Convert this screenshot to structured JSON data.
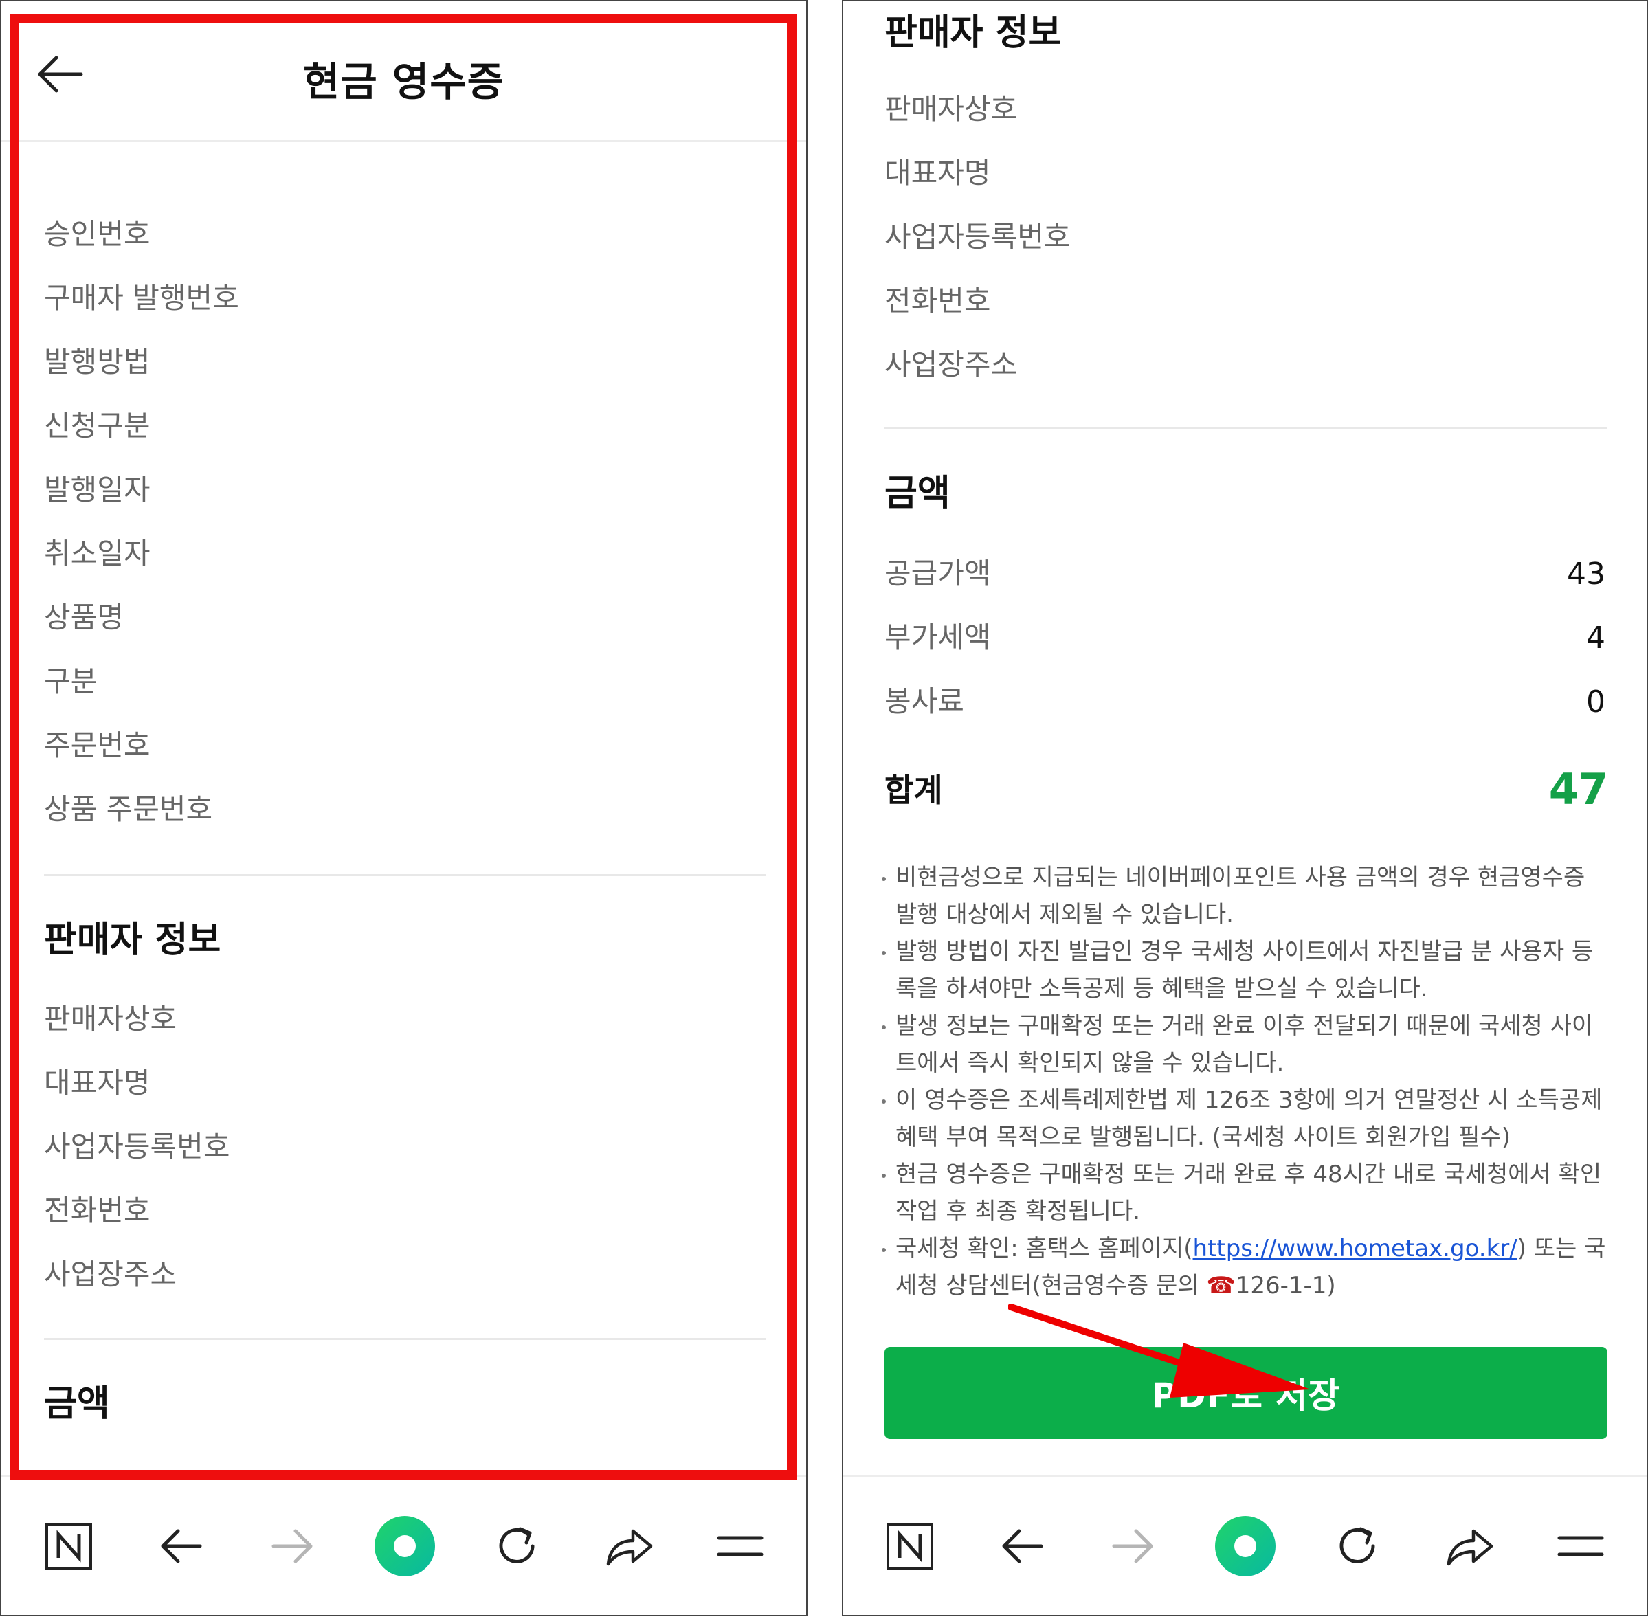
{
  "left": {
    "header_title": "현금 영수증",
    "receipt_fields": [
      "승인번호",
      "구매자 발행번호",
      "발행방법",
      "신청구분",
      "발행일자",
      "취소일자",
      "상품명",
      "구분",
      "주문번호",
      "상품 주문번호"
    ],
    "seller_title": "판매자 정보",
    "seller_fields": [
      "판매자상호",
      "대표자명",
      "사업자등록번호",
      "전화번호",
      "사업장주소"
    ],
    "amount_title": "금액"
  },
  "right": {
    "seller_title": "판매자 정보",
    "seller_fields": [
      "판매자상호",
      "대표자명",
      "사업자등록번호",
      "전화번호",
      "사업장주소"
    ],
    "amount_title": "금액",
    "amounts": [
      {
        "label": "공급가액",
        "value": "43"
      },
      {
        "label": "부가세액",
        "value": "4"
      },
      {
        "label": "봉사료",
        "value": "0"
      }
    ],
    "total_label": "합계",
    "total_value": "47",
    "notes": [
      "비현금성으로 지급되는 네이버페이포인트 사용 금액의 경우 현금영수증 발행 대상에서 제외될 수 있습니다.",
      "발행 방법이 자진 발급인 경우 국세청 사이트에서 자진발급 분 사용자 등록을 하셔야만 소득공제 등 혜택을 받으실 수 있습니다.",
      "발생 정보는 구매확정 또는 거래 완료 이후 전달되기 때문에 국세청 사이트에서 즉시 확인되지 않을 수 있습니다.",
      "이 영수증은 조세특례제한법 제 126조 3항에 의거 연말정산 시 소득공제혜택 부여 목적으로 발행됩니다. (국세청 사이트 회원가입 필수)",
      "현금 영수증은 구매확정 또는 거래 완료 후 48시간 내로 국세청에서 확인 작업 후 최종 확정됩니다."
    ],
    "hometax_note": {
      "prefix": "국세청 확인: 홈택스 홈페이지(",
      "link": "https://www.hometax.go.kr/",
      "suffix": ") 또는 국세청 상담센터(현금영수증 문의 ",
      "phone_glyph": "☎",
      "phone": "126-1-1)"
    },
    "pdf_button": "PDF로 저장"
  },
  "bottom_nav_icons": [
    "naver-n-icon",
    "back-arrow-icon",
    "forward-arrow-icon",
    "home-circle-icon",
    "refresh-icon",
    "share-icon",
    "menu-icon"
  ],
  "colors": {
    "accent_green": "#0cae4a",
    "total_green": "#14a048",
    "highlight_red": "#ee0e0e",
    "link_blue": "#1a55d6"
  }
}
